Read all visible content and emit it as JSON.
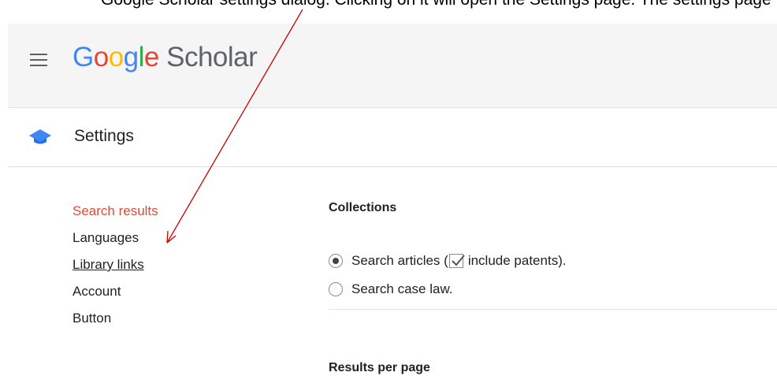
{
  "caption": {
    "text": "Google Scholar settings dialog. Clicking on it will open the Settings page. The settings page"
  },
  "header": {
    "logo_google": [
      "G",
      "o",
      "o",
      "g",
      "l",
      "e"
    ],
    "logo_colors": [
      "#4285f4",
      "#ea4335",
      "#fbbc05",
      "#4285f4",
      "#34a853",
      "#ea4335"
    ],
    "logo_scholar": "Scholar"
  },
  "subheader": {
    "title": "Settings"
  },
  "nav": {
    "items": [
      {
        "label": "Search results"
      },
      {
        "label": "Languages"
      },
      {
        "label": "Library links"
      },
      {
        "label": "Account"
      },
      {
        "label": "Button"
      }
    ]
  },
  "content": {
    "collections_title": "Collections",
    "option_articles_prefix": "Search articles (",
    "option_articles_suffix": " include patents).",
    "option_caselaw": "Search case law.",
    "results_title": "Results per page"
  },
  "state": {
    "articles_selected": true,
    "include_patents_checked": true,
    "caselaw_selected": false
  },
  "colors": {
    "active_nav": "#dd4b39",
    "arrow": "#cc0000",
    "header_bg": "#f5f5f5"
  }
}
